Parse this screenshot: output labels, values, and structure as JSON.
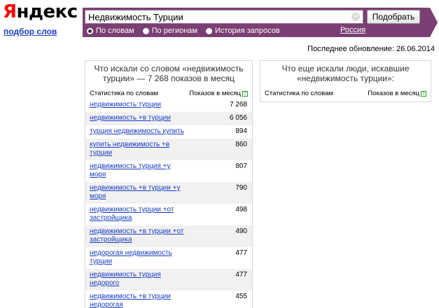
{
  "logo": {
    "first": "Я",
    "rest": "ндекс"
  },
  "sublink": "подбор слов",
  "search": {
    "value": "Недвижимость Турции",
    "submit": "Подобрать"
  },
  "modes": [
    {
      "label": "По словам",
      "checked": true
    },
    {
      "label": "По регионам",
      "checked": false
    },
    {
      "label": "История запросов",
      "checked": false
    }
  ],
  "region": "Россия",
  "updated": "Последнее обновление: 26.06.2014",
  "left": {
    "title": "Что искали со словом «недвижимость турции» — 7 268 показов в месяц",
    "col_keyword": "Статистика по словам",
    "col_count": "Показов в месяц",
    "rows": [
      {
        "kw": "недвижимость турции",
        "count": "7 268"
      },
      {
        "kw": "недвижимость +в турции",
        "count": "6 056"
      },
      {
        "kw": "турция недвижимость купить",
        "count": "894"
      },
      {
        "kw": "купить недвижимость +в турции",
        "count": "860"
      },
      {
        "kw": "недвижимость турция +у моря",
        "count": "807"
      },
      {
        "kw": "недвижимость +в турции +у моря",
        "count": "790"
      },
      {
        "kw": "недвижимость турции +от застройщика",
        "count": "498"
      },
      {
        "kw": "недвижимость +в турции +от застройщика",
        "count": "490"
      },
      {
        "kw": "недорогая недвижимость турции",
        "count": "477"
      },
      {
        "kw": "недвижимость турция недорого",
        "count": "477"
      },
      {
        "kw": "недвижимость +в турции недорогая",
        "count": "455"
      }
    ]
  },
  "right": {
    "title": "Что еще искали люди, искавшие «недвижимость турции»:",
    "col_keyword": "Статистика по словам",
    "col_count": "Показов в месяц"
  }
}
